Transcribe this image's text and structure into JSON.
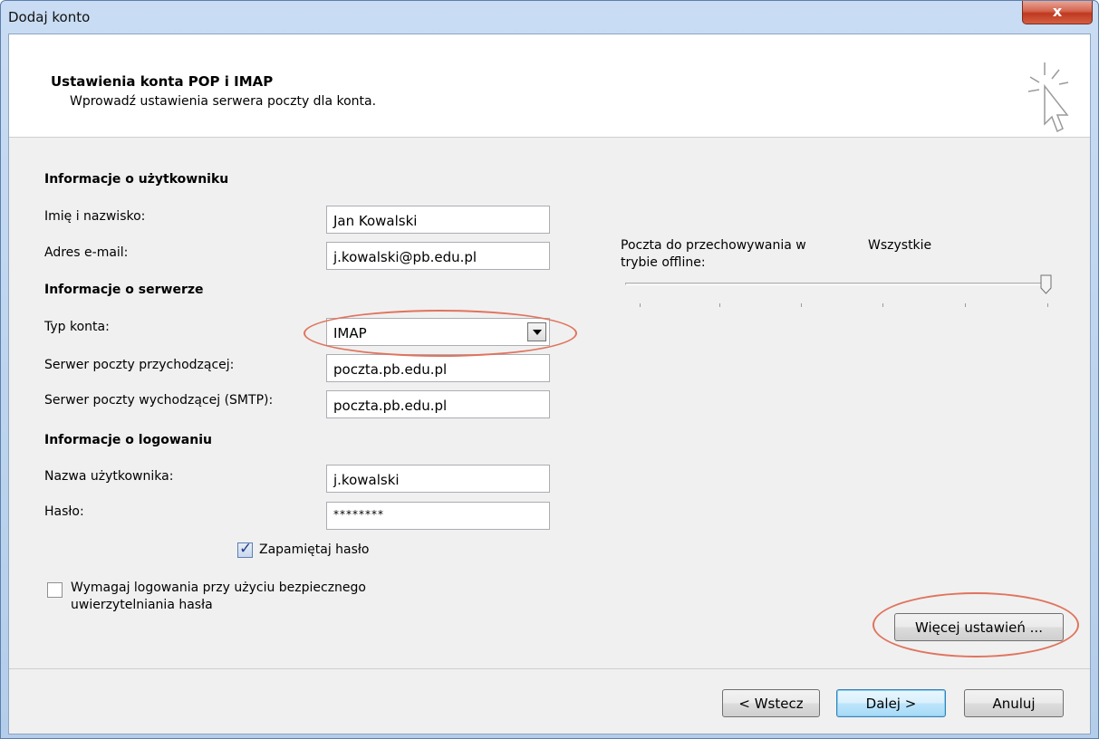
{
  "window": {
    "title": "Dodaj konto",
    "close_glyph": "x"
  },
  "header": {
    "title": "Ustawienia konta POP i IMAP",
    "subtitle": "Wprowadź ustawienia serwera poczty dla konta.",
    "icon": "cursor-click-icon"
  },
  "user_info": {
    "heading": "Informacje o użytkowniku",
    "name_label": "Imię i nazwisko:",
    "name_value": "Jan Kowalski",
    "email_label": "Adres e-mail:",
    "email_value": "j.kowalski@pb.edu.pl"
  },
  "server_info": {
    "heading": "Informacje o serwerze",
    "type_label": "Typ konta:",
    "type_value": "IMAP",
    "incoming_label": "Serwer poczty przychodzącej:",
    "incoming_value": "poczta.pb.edu.pl",
    "outgoing_label": "Serwer poczty wychodzącej (SMTP):",
    "outgoing_value": "poczta.pb.edu.pl"
  },
  "login_info": {
    "heading": "Informacje o logowaniu",
    "user_label": "Nazwa użytkownika:",
    "user_value": "j.kowalski",
    "password_label": "Hasło:",
    "password_value": "********",
    "remember_label": "Zapamiętaj hasło",
    "remember_checked": true,
    "spa_label_line1": "Wymagaj logowania przy użyciu bezpiecznego",
    "spa_label_line2": "uwierzytelniania hasła",
    "spa_checked": false
  },
  "offline": {
    "label_line1": "Poczta do przechowywania w",
    "label_line2": "trybie offline:",
    "value": "Wszystkie",
    "slider_position": 1.0
  },
  "buttons": {
    "more_settings": "Więcej ustawień ...",
    "back": "< Wstecz",
    "next": "Dalej >",
    "cancel": "Anuluj"
  },
  "colors": {
    "annotation": "#e0745e",
    "titlebar": "#b4cdea"
  }
}
